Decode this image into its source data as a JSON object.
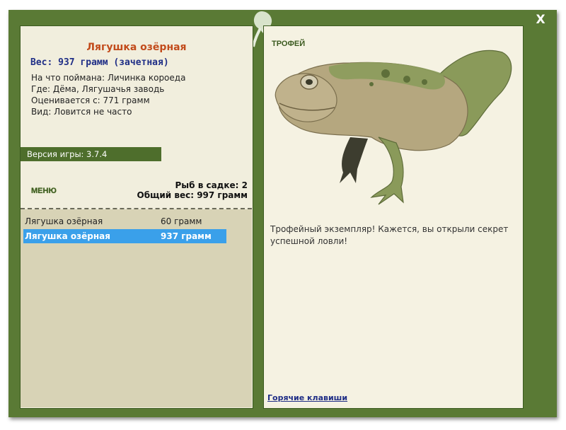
{
  "window": {
    "close_label": "X"
  },
  "fish": {
    "name": "Лягушка озёрная",
    "weight_label": "Вес: 937 грамм (зачетная)",
    "bait": "На что поймана: Личинка короеда",
    "location": "Где: Дёма, Лягушачья заводь",
    "valued_from": "Оценивается с: 771 грамм",
    "frequency": "Вид: Ловится не часто"
  },
  "game_version": "Версия игры: 3.7.4",
  "menu_label": "МЕНЮ",
  "cage": {
    "count_label": "Рыб в садке: 2",
    "total_label": "Общий вес: 997 грамм",
    "items": [
      {
        "name": "Лягушка озёрная",
        "weight": "60 грамм",
        "selected": false
      },
      {
        "name": "Лягушка озёрная",
        "weight": "937 грамм",
        "selected": true
      }
    ]
  },
  "trophy": {
    "label": "ТРОФЕЙ",
    "description": "Трофейный экземпляр! Кажется, вы открыли секрет успешной ловли!"
  },
  "hotkeys_label": "Горячие клавиши",
  "colors": {
    "frame": "#5a7a35",
    "title": "#c24b1b",
    "weight": "#1f2e86",
    "selected_row": "#3aa0ea"
  },
  "icons": {
    "leaf": "leaf-logo-icon",
    "frog": "frog-trophy-image"
  }
}
